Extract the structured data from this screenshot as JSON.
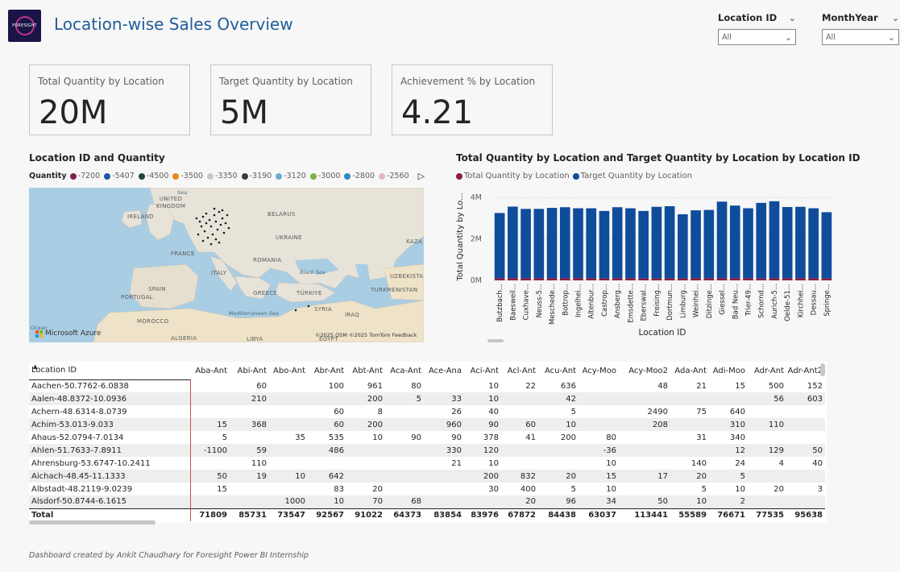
{
  "header": {
    "logo_text": "FORESIGHT",
    "title": "Location-wise Sales Overview"
  },
  "slicers": [
    {
      "label": "Location ID",
      "value": "All"
    },
    {
      "label": "MonthYear",
      "value": "All"
    }
  ],
  "cards": [
    {
      "title": "Total Quantity by Location",
      "value": "20M"
    },
    {
      "title": "Target Quantity by Location",
      "value": "5M"
    },
    {
      "title": "Achievement % by Location",
      "value": "4.21"
    }
  ],
  "map": {
    "title": "Location ID and Quantity",
    "legend_title": "Quantity",
    "legend": [
      {
        "label": "-7200",
        "color": "#7b2451"
      },
      {
        "label": "-5407",
        "color": "#1e57a4"
      },
      {
        "label": "-4500",
        "color": "#1d4a2b"
      },
      {
        "label": "-3500",
        "color": "#e8891b"
      },
      {
        "label": "-3350",
        "color": "#c8c8c8"
      },
      {
        "label": "-3190",
        "color": "#3a3a3a"
      },
      {
        "label": "-3120",
        "color": "#6aaed6"
      },
      {
        "label": "-3000",
        "color": "#7cb342"
      },
      {
        "label": "-2800",
        "color": "#2b8cbe"
      },
      {
        "label": "-2560",
        "color": "#e6b6bd"
      }
    ],
    "labels": [
      {
        "text": "UNITED KINGDOM"
      },
      {
        "text": "IRELAND"
      },
      {
        "text": "BELARUS"
      },
      {
        "text": "UKRAINE"
      },
      {
        "text": "FRANCE"
      },
      {
        "text": "ITALY"
      },
      {
        "text": "ROMANIA"
      },
      {
        "text": "SPAIN"
      },
      {
        "text": "PORTUGAL"
      },
      {
        "text": "GREECE"
      },
      {
        "text": "TÜRKIYE"
      },
      {
        "text": "MOROCCO"
      },
      {
        "text": "ALGERIA"
      },
      {
        "text": "SYRIA"
      },
      {
        "text": "IRAQ"
      },
      {
        "text": "TURKMENISTAN"
      },
      {
        "text": "UZBEKISTA"
      },
      {
        "text": "KAZA"
      },
      {
        "text": "LIBYA"
      },
      {
        "text": "EGYPT"
      },
      {
        "text": "Black Sea"
      },
      {
        "text": "Mediterranean Sea"
      },
      {
        "text": "Sea"
      },
      {
        "text": "Ocean"
      }
    ],
    "brand": "Microsoft Azure",
    "credit": "©2025 OSM  ©2025 TomTom  Feedback"
  },
  "bar_chart": {
    "title": "Total Quantity by Location and Target Quantity by Location by Location ID",
    "legend": [
      {
        "label": "Total Quantity by Location",
        "color": "#8b1e3f"
      },
      {
        "label": "Target Quantity by Location",
        "color": "#0f4c9c"
      }
    ]
  },
  "chart_data": {
    "type": "bar",
    "title": "Total Quantity by Location and Target Quantity by Location by Location ID",
    "xlabel": "Location ID",
    "ylabel": "Total Quantity by Lo...",
    "yticks": [
      "0M",
      "2M",
      "4M"
    ],
    "ylim": [
      0,
      4200000
    ],
    "categories": [
      "Butzbach...",
      "Baesweil...",
      "Cuxhave...",
      "Neuss-5...",
      "Meschede...",
      "Bottrop...",
      "Ingelhei...",
      "Altenbur...",
      "Castrop...",
      "Ansberg...",
      "Emsdette...",
      "Eberswal...",
      "Freising...",
      "Dortmun...",
      "Limburg...",
      "Weinhei...",
      "Ditzinge...",
      "Giessel...",
      "Bad Neu...",
      "Trier-49...",
      "Schornd...",
      "Aurich-5...",
      "Oelde-51...",
      "Kirchhei...",
      "Dessau...",
      "Springe..."
    ],
    "series": [
      {
        "name": "Total Quantity by Location",
        "values": [
          100000,
          110000,
          100000,
          100000,
          100000,
          100000,
          100000,
          100000,
          90000,
          100000,
          100000,
          90000,
          90000,
          100000,
          90000,
          100000,
          100000,
          100000,
          100000,
          100000,
          90000,
          100000,
          100000,
          100000,
          100000,
          90000
        ]
      },
      {
        "name": "Target Quantity by Location",
        "values": [
          3150000,
          3450000,
          3350000,
          3350000,
          3400000,
          3430000,
          3380000,
          3380000,
          3260000,
          3430000,
          3380000,
          3260000,
          3460000,
          3480000,
          3100000,
          3280000,
          3300000,
          3700000,
          3510000,
          3380000,
          3650000,
          3720000,
          3440000,
          3450000,
          3380000,
          3200000
        ]
      }
    ],
    "legend": "top-left",
    "grid": true
  },
  "table": {
    "columns": [
      "Location ID",
      "Aba-Ant",
      "Abi-Ant",
      "Abo-Ant",
      "Abr-Ant",
      "Abt-Ant",
      "Aca-Ant",
      "Ace-Ana",
      "Aci-Ant",
      "Acl-Ant",
      "Acu-Ant",
      "Acy-Moo",
      "Acy-Moo2",
      "Ada-Ant",
      "Adi-Moo",
      "Adr-Ant",
      "Adr-Ant2"
    ],
    "rows": [
      [
        "Aachen-50.7762-6.0838",
        "",
        "60",
        "",
        "100",
        "961",
        "80",
        "",
        "10",
        "22",
        "636",
        "",
        "48",
        "21",
        "15",
        "500",
        "152"
      ],
      [
        "Aalen-48.8372-10.0936",
        "",
        "210",
        "",
        "",
        "200",
        "5",
        "33",
        "10",
        "",
        "42",
        "",
        "",
        "",
        "",
        "56",
        "603"
      ],
      [
        "Achern-48.6314-8.0739",
        "",
        "",
        "",
        "60",
        "8",
        "",
        "26",
        "40",
        "",
        "5",
        "",
        "2490",
        "75",
        "640",
        "",
        ""
      ],
      [
        "Achim-53.013-9.033",
        "15",
        "368",
        "",
        "60",
        "200",
        "",
        "960",
        "90",
        "60",
        "10",
        "",
        "208",
        "",
        "310",
        "110",
        ""
      ],
      [
        "Ahaus-52.0794-7.0134",
        "5",
        "",
        "35",
        "535",
        "10",
        "90",
        "90",
        "378",
        "41",
        "200",
        "80",
        "",
        "31",
        "340",
        "",
        ""
      ],
      [
        "Ahlen-51.7633-7.8911",
        "-1100",
        "59",
        "",
        "486",
        "",
        "",
        "330",
        "120",
        "",
        "",
        "-36",
        "",
        "",
        "12",
        "129",
        "50"
      ],
      [
        "Ahrensburg-53.6747-10.2411",
        "",
        "110",
        "",
        "",
        "",
        "",
        "21",
        "10",
        "",
        "",
        "10",
        "",
        "140",
        "24",
        "4",
        "40"
      ],
      [
        "Aichach-48.45-11.1333",
        "50",
        "19",
        "10",
        "642",
        "",
        "",
        "",
        "200",
        "832",
        "20",
        "15",
        "17",
        "20",
        "5",
        "",
        ""
      ],
      [
        "Albstadt-48.2119-9.0239",
        "15",
        "",
        "",
        "83",
        "20",
        "",
        "",
        "30",
        "400",
        "5",
        "10",
        "",
        "5",
        "10",
        "20",
        "3"
      ],
      [
        "Alsdorf-50.8744-6.1615",
        "",
        "",
        "1000",
        "10",
        "70",
        "68",
        "",
        "",
        "20",
        "96",
        "34",
        "50",
        "10",
        "2",
        "",
        ""
      ]
    ],
    "total": [
      "Total",
      "71809",
      "85731",
      "73547",
      "92567",
      "91022",
      "64373",
      "83854",
      "83976",
      "67872",
      "84438",
      "63037",
      "113441",
      "55589",
      "76671",
      "77535",
      "95638"
    ]
  },
  "footer": "Dashboard created by Ankit Chaudhary for Foresight Power BI Internship"
}
